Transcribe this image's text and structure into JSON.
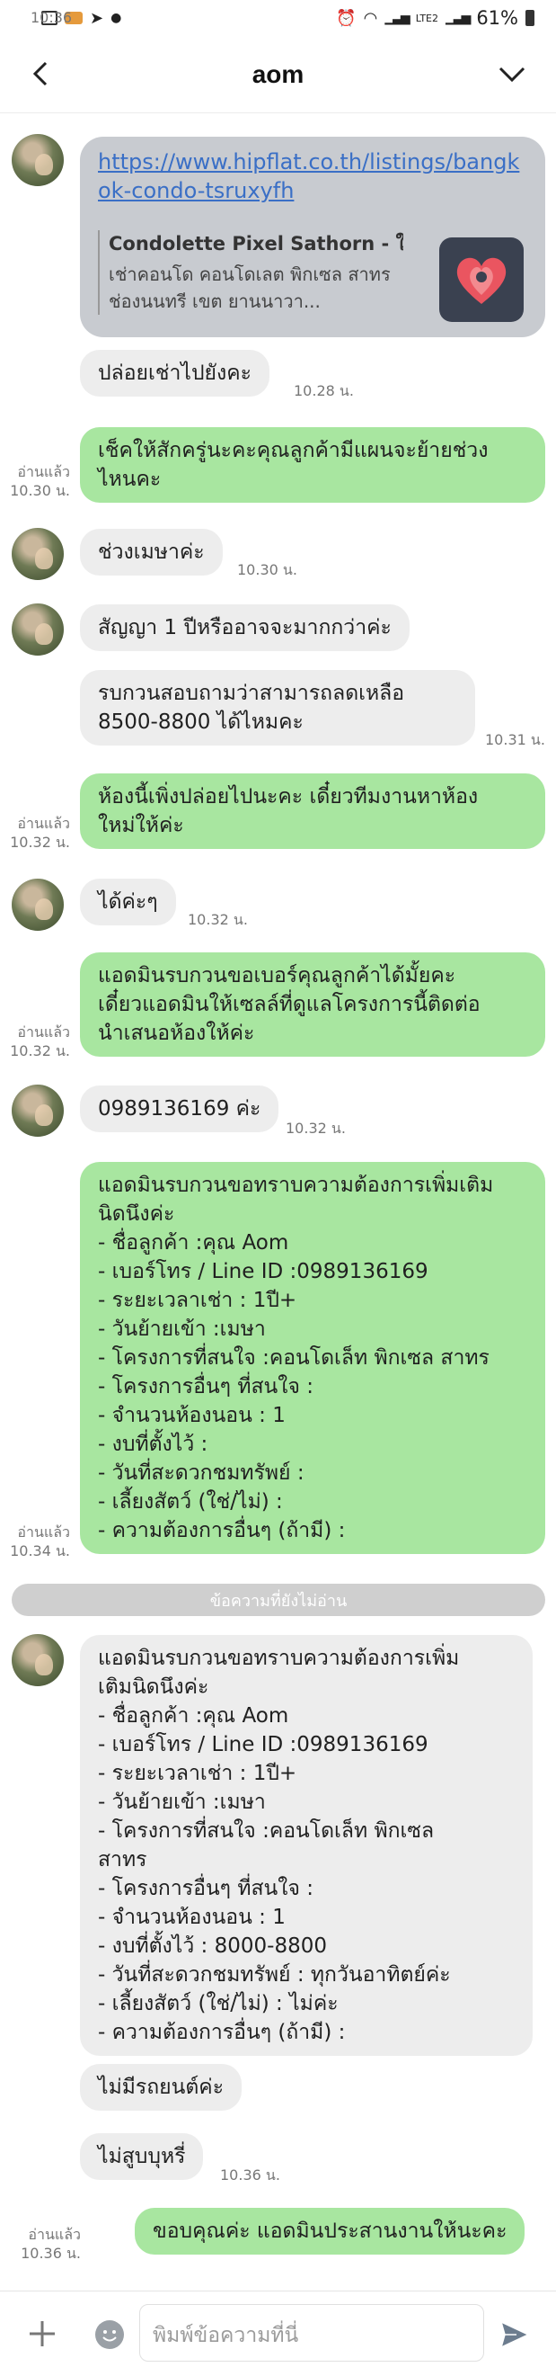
{
  "status": {
    "time": "10:36",
    "battery": "61%",
    "network": "LTE2"
  },
  "header": {
    "title": "aom"
  },
  "card": {
    "url": "https://www.hipflat.co.th/listings/bangkok-condo-tsruxyfh",
    "preview_title": "Condolette Pixel Sathorn - ให้เ...",
    "preview_desc": "เช่าคอนโด คอนโดเลต พิกเซล สาทร ช่องนนทรี เขต ยานนาวา..."
  },
  "messages": [
    {
      "id": "m1",
      "text": "ปล่อยเช่าไปยังคะ",
      "time": "10.28 น."
    },
    {
      "id": "m2",
      "text": "เช็คให้สักครู่นะคะคุณลูกค้ามีแผนจะย้ายช่วง\nไหนคะ",
      "read": "อ่านแล้ว\n10.30 น."
    },
    {
      "id": "m3",
      "text": "ช่วงเมษาค่ะ",
      "time": "10.30 น."
    },
    {
      "id": "m4",
      "text": "สัญญา 1 ปีหรืออาจจะมากกว่าค่ะ"
    },
    {
      "id": "m5",
      "text": "รบกวนสอบถามว่าสามารถลดเหลือ\n8500-8800 ได้ไหมคะ",
      "time": "10.31 น."
    },
    {
      "id": "m6",
      "text": "ห้องนี้เพิ่งปล่อยไปนะคะ เดี๋ยวทีมงานหาห้อง\nใหม่ให้ค่ะ",
      "read": "อ่านแล้ว\n10.32 น."
    },
    {
      "id": "m7",
      "text": "ได้ค่ะๆ",
      "time": "10.32 น."
    },
    {
      "id": "m8",
      "text": "แอดมินรบกวนขอเบอร์คุณลูกค้าได้มั้ยคะ\nเดี๋ยวแอดมินให้เซลล์ที่ดูแลโครงการนี้ติดต่อ\nนำเสนอห้องให้ค่ะ",
      "read": "อ่านแล้ว\n10.32 น."
    },
    {
      "id": "m9",
      "text": "0989136169 ค่ะ",
      "time": "10.32 น."
    },
    {
      "id": "m10",
      "text": "แอดมินรบกวนขอทราบความต้องการเพิ่มเติม\nนิดนึงค่ะ\n- ชื่อลูกค้า :คุณ Aom\n- เบอร์โทร / Line ID :0989136169\n- ระยะเวลาเช่า : 1ปี+\n- วันย้ายเข้า :เมษา\n- โครงการที่สนใจ :คอนโดเล็ท พิกเซล สาทร\n- โครงการอื่นๆ ที่สนใจ :\n- จำนวนห้องนอน : 1\n- งบที่ตั้งไว้ :\n- วันที่สะดวกชมทรัพย์ :\n- เลี้ยงสัตว์ (ใช่/ไม่) :\n- ความต้องการอื่นๆ (ถ้ามี) :",
      "read": "อ่านแล้ว\n10.34 น."
    },
    {
      "id": "m11",
      "text": "แอดมินรบกวนขอทราบความต้องการเพิ่ม\nเติมนิดนึงค่ะ\n- ชื่อลูกค้า :คุณ Aom\n- เบอร์โทร / Line ID :0989136169\n- ระยะเวลาเช่า : 1ปี+\n- วันย้ายเข้า :เมษา\n- โครงการที่สนใจ :คอนโดเล็ท พิกเซล\nสาทร\n- โครงการอื่นๆ ที่สนใจ :\n- จำนวนห้องนอน : 1\n- งบที่ตั้งไว้ : 8000-8800\n- วันที่สะดวกชมทรัพย์ : ทุกวันอาทิตย์ค่ะ\n- เลี้ยงสัตว์ (ใช่/ไม่) : ไม่ค่ะ\n- ความต้องการอื่นๆ (ถ้ามี) :"
    },
    {
      "id": "m12",
      "text": "ไม่มีรถยนต์ค่ะ"
    },
    {
      "id": "m13",
      "text": "ไม่สูบบุหรี่",
      "time": "10.36 น."
    },
    {
      "id": "m14",
      "text": "ขอบคุณค่ะ แอดมินประสานงานให้นะคะ",
      "read": "อ่านแล้ว\n10.36 น."
    }
  ],
  "divider": "ข้อความที่ยังไม่อ่าน",
  "composer": {
    "placeholder": "พิมพ์ข้อความที่นี่"
  },
  "colors": {
    "outgoing": "#a8e6a0",
    "incoming": "#ededed",
    "link": "#3a6fc6"
  }
}
